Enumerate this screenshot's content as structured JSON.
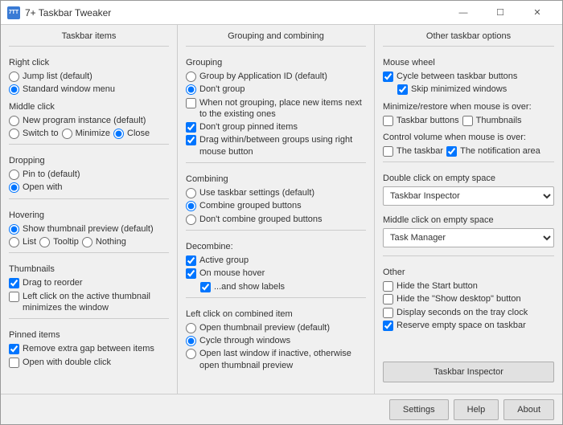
{
  "window": {
    "icon": "7TT",
    "title": "7+ Taskbar Tweaker",
    "minimize_label": "—",
    "maximize_label": "☐",
    "close_label": "✕"
  },
  "columns": {
    "col1": {
      "header": "Taskbar items",
      "sections": {
        "right_click": {
          "label": "Right click",
          "options": [
            "Jump list (default)",
            "Standard window menu"
          ],
          "selected": 1
        },
        "middle_click": {
          "label": "Middle click",
          "options": [
            "New program instance (default)"
          ],
          "inline": [
            "Switch to",
            "Minimize",
            "Close"
          ],
          "inline_selected": 2
        },
        "dropping": {
          "label": "Dropping",
          "options": [
            "Pin to (default)",
            "Open with"
          ],
          "selected": 1
        },
        "hovering": {
          "label": "Hovering",
          "options": [
            "Show thumbnail preview (default)"
          ],
          "inline": [
            "List",
            "Tooltip",
            "Nothing"
          ],
          "inline_selected": -1
        },
        "thumbnails": {
          "label": "Thumbnails",
          "checkboxes": [
            {
              "label": "Drag to reorder",
              "checked": true
            },
            {
              "label": "Left click on the active thumbnail minimizes the window",
              "checked": false
            }
          ]
        },
        "pinned_items": {
          "label": "Pinned items",
          "checkboxes": [
            {
              "label": "Remove extra gap between items",
              "checked": true
            },
            {
              "label": "Open with double click",
              "checked": false
            }
          ]
        }
      }
    },
    "col2": {
      "header": "Grouping and combining",
      "sections": {
        "grouping": {
          "label": "Grouping",
          "options": [
            "Group by Application ID (default)",
            "Don't group",
            "When not grouping, place new items next to the existing ones",
            "Don't group pinned items",
            "Drag within/between groups using right mouse button"
          ],
          "selected": 1,
          "checkboxes": [
            2,
            3,
            4
          ]
        },
        "combining": {
          "label": "Combining",
          "options": [
            "Use taskbar settings (default)",
            "Combine grouped buttons",
            "Don't combine grouped buttons"
          ],
          "selected": 1
        },
        "decombine": {
          "label": "Decombine:",
          "checkboxes": [
            {
              "label": "Active group",
              "checked": true
            },
            {
              "label": "On mouse hover",
              "checked": true
            },
            {
              "label": "...and show labels",
              "checked": true,
              "indent": true
            }
          ]
        },
        "left_click": {
          "label": "Left click on combined item",
          "options": [
            "Open thumbnail preview (default)",
            "Cycle through windows",
            "Open last window if inactive, otherwise open thumbnail preview"
          ],
          "selected": 1
        }
      }
    },
    "col3": {
      "header": "Other taskbar options",
      "sections": {
        "mouse_wheel": {
          "label": "Mouse wheel",
          "checkboxes": [
            {
              "label": "Cycle between taskbar buttons",
              "checked": true
            },
            {
              "label": "Skip minimized windows",
              "checked": true,
              "indent": true
            }
          ]
        },
        "minimize_restore": {
          "label": "Minimize/restore when mouse is over:",
          "inline": [
            "Taskbar buttons",
            "Thumbnails"
          ]
        },
        "control_volume": {
          "label": "Control volume when mouse is over:",
          "inline": [
            {
              "label": "The taskbar",
              "checked": false
            },
            {
              "label": "The notification area",
              "checked": true
            }
          ]
        },
        "double_click": {
          "label": "Double click on empty space",
          "dropdown_value": "Taskbar Inspector"
        },
        "middle_click": {
          "label": "Middle click on empty space",
          "dropdown_value": "Task Manager"
        },
        "other": {
          "label": "Other",
          "checkboxes": [
            {
              "label": "Hide the Start button",
              "checked": false
            },
            {
              "label": "Hide the \"Show desktop\" button",
              "checked": false
            },
            {
              "label": "Display seconds on the tray clock",
              "checked": false
            },
            {
              "label": "Reserve empty space on taskbar",
              "checked": true
            }
          ]
        }
      }
    }
  },
  "bottom": {
    "taskbar_inspector_label": "Taskbar Inspector",
    "settings_label": "Settings",
    "help_label": "Help",
    "about_label": "About"
  }
}
